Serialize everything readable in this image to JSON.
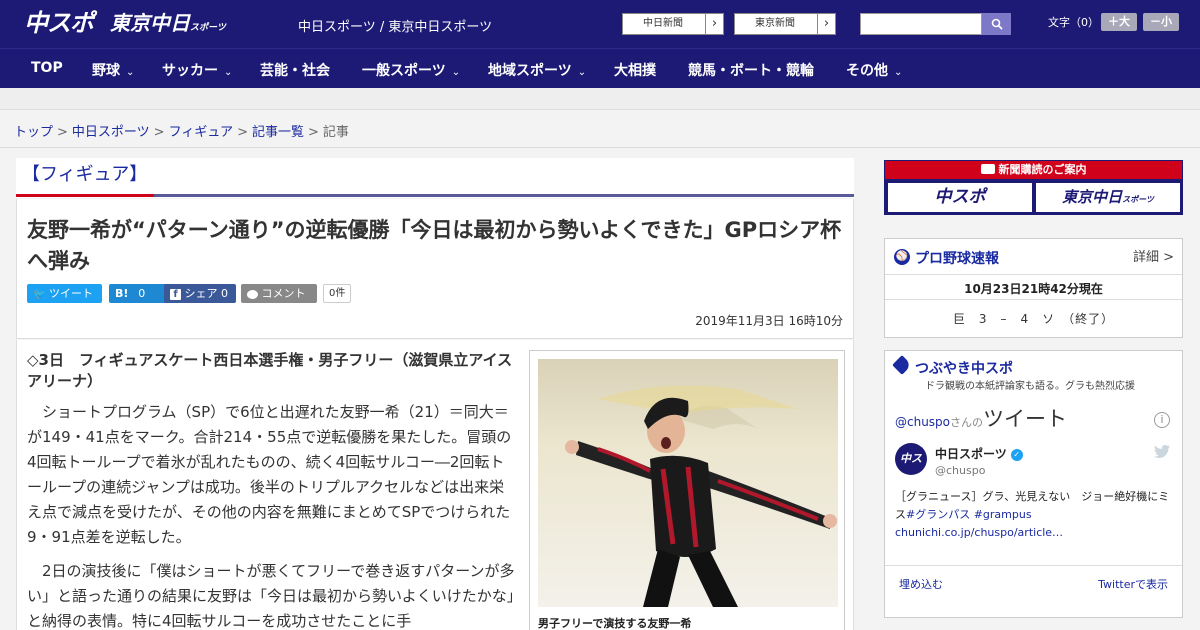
{
  "header": {
    "logo_main": "中スポ",
    "logo_tokyo": "東京中日",
    "logo_tokyo_small": "スポーツ",
    "site_names": "中日スポーツ / 東京中日スポーツ",
    "link_chunichi": "中日新聞",
    "link_tokyo": "東京新聞",
    "link_arrow": "›",
    "search_icon_glyph": "⚲",
    "font_label": "文字（0）",
    "font_larger": "＋大",
    "font_smaller": "－小"
  },
  "nav": {
    "items": [
      {
        "label": "TOP",
        "dropdown": false
      },
      {
        "label": "野球",
        "dropdown": true
      },
      {
        "label": "サッカー",
        "dropdown": true
      },
      {
        "label": "芸能・社会",
        "dropdown": false
      },
      {
        "label": "一般スポーツ",
        "dropdown": true
      },
      {
        "label": "地域スポーツ",
        "dropdown": true
      },
      {
        "label": "大相撲",
        "dropdown": false
      },
      {
        "label": "競馬・ボート・競輪",
        "dropdown": false
      },
      {
        "label": "その他",
        "dropdown": true
      }
    ],
    "chevron": "⌄"
  },
  "breadcrumb": {
    "items": [
      "トップ",
      "中日スポーツ",
      "フィギュア",
      "記事一覧"
    ],
    "current": "記事",
    "separator": ">"
  },
  "category": {
    "title": "【フィギュア】"
  },
  "article": {
    "title": "友野一希が“パターン通り”の逆転優勝「今日は最初から勢いよくできた」GPロシア杯へ弾み",
    "share": {
      "tweet": "ツイート",
      "hatena_label": "B!",
      "hatena_count": "0",
      "facebook": "シェア",
      "facebook_count": "0",
      "comment": "コメント",
      "comment_count": "0件"
    },
    "date": "2019年11月3日 16時10分",
    "lead": "◇3日　フィギュアスケート西日本選手権・男子フリー（滋賀県立アイスアリーナ）",
    "paragraphs": [
      "ショートプログラム（SP）で6位と出遅れた友野一希（21）＝同大＝が149・41点をマーク。合計214・55点で逆転優勝を果たした。冒頭の4回転トーループで着氷が乱れたものの、続く4回転サルコー―2回転トーループの連続ジャンプは成功。後半のトリプルアクセルなどは出来栄え点で減点を受けたが、その他の内容を無難にまとめてSPでつけられた9・91点差を逆転した。",
      "2日の演技後に「僕はショートが悪くてフリーで巻き返すパターンが多い」と語った通りの結果に友野は「今日は最初から勢いよくいけたかな」と納得の表情。特に4回転サルコーを成功させたことに手"
    ],
    "photo_caption": "男子フリーで演技する友野一希"
  },
  "sidebar": {
    "subscribe": {
      "title": "新聞購読のご案内",
      "logo_left": "中スポ",
      "logo_right": "東京中日",
      "logo_right_small": "スポーツ"
    },
    "baseball": {
      "title": "プロ野球速報",
      "detail": "詳細 >",
      "time": "10月23日21時42分現在",
      "score": "巨　3　–　4　ソ　（終了）"
    },
    "twitter": {
      "title": "つぶやき中スポ",
      "subtitle": "ドラ観戦の本紙評論家も語る。グラも熱烈応援",
      "handle": "@chuspo",
      "handle_suffix": "さんの",
      "handle_tweet": "ツイート",
      "info_glyph": "i",
      "avatar_text": "中スポ",
      "account_name": "中日スポーツ",
      "verified_glyph": "✓",
      "bird_glyph": "🐦",
      "account_user": "@chuspo",
      "tweet_text": "［グラニュース］グラ、光見えない　ジョー絶好機にミス",
      "tweet_tags": "#グランパス #grampus",
      "tweet_link": "chunichi.co.jp/chuspo/article…",
      "embed": "埋め込む",
      "view_on": "Twitterで表示"
    }
  },
  "colors": {
    "brand_navy": "#1d1a75",
    "accent_red": "#d0021b",
    "link_blue": "#1a2aa0",
    "twitter_blue": "#1da1f2",
    "hatena_blue": "#1e88d2",
    "facebook_blue": "#3b5998",
    "comment_gray": "#888888"
  }
}
